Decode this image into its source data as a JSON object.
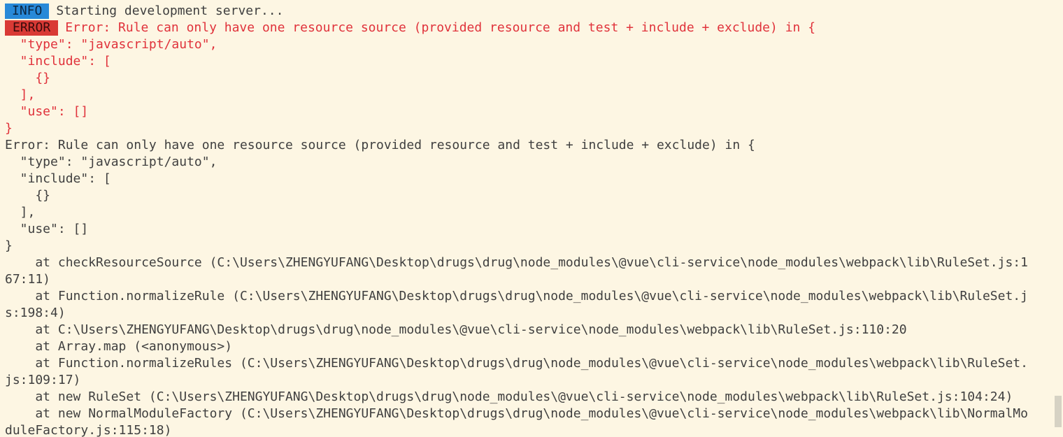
{
  "info_badge": "INFO",
  "info_message": "Starting development server...",
  "error_badge": "ERROR",
  "error_block": [
    "Error: Rule can only have one resource source (provided resource and test + include + exclude) in {",
    "  \"type\": \"javascript/auto\",",
    "  \"include\": [",
    "    {}",
    "  ],",
    "  \"use\": []",
    "}"
  ],
  "plain_block": [
    "Error: Rule can only have one resource source (provided resource and test + include + exclude) in {",
    "  \"type\": \"javascript/auto\",",
    "  \"include\": [",
    "    {}",
    "  ],",
    "  \"use\": []",
    "}",
    "    at checkResourceSource (C:\\Users\\ZHENGYUFANG\\Desktop\\drugs\\drug\\node_modules\\@vue\\cli-service\\node_modules\\webpack\\lib\\RuleSet.js:1",
    "67:11)",
    "    at Function.normalizeRule (C:\\Users\\ZHENGYUFANG\\Desktop\\drugs\\drug\\node_modules\\@vue\\cli-service\\node_modules\\webpack\\lib\\RuleSet.j",
    "s:198:4)",
    "    at C:\\Users\\ZHENGYUFANG\\Desktop\\drugs\\drug\\node_modules\\@vue\\cli-service\\node_modules\\webpack\\lib\\RuleSet.js:110:20",
    "    at Array.map (<anonymous>)",
    "    at Function.normalizeRules (C:\\Users\\ZHENGYUFANG\\Desktop\\drugs\\drug\\node_modules\\@vue\\cli-service\\node_modules\\webpack\\lib\\RuleSet.",
    "js:109:17)",
    "    at new RuleSet (C:\\Users\\ZHENGYUFANG\\Desktop\\drugs\\drug\\node_modules\\@vue\\cli-service\\node_modules\\webpack\\lib\\RuleSet.js:104:24)",
    "    at new NormalModuleFactory (C:\\Users\\ZHENGYUFANG\\Desktop\\drugs\\drug\\node_modules\\@vue\\cli-service\\node_modules\\webpack\\lib\\NormalMo",
    "duleFactory.js:115:18)"
  ],
  "colors": {
    "background": "#fdf6e3",
    "text": "#3f3f3f",
    "error_text": "#e0323b",
    "info_badge": "#2889d8",
    "error_badge": "#d93a35"
  }
}
